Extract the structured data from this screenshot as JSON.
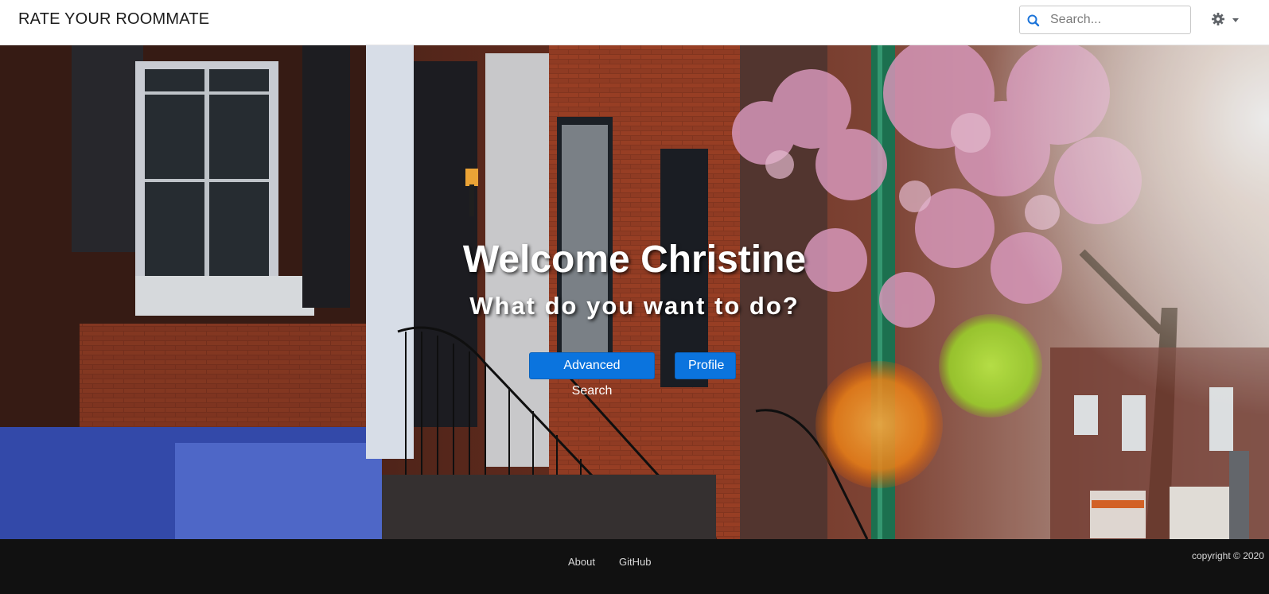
{
  "header": {
    "brand": "RATE YOUR ROOMMATE",
    "search": {
      "placeholder": "Search...",
      "value": ""
    },
    "settings_icon": "gear-icon",
    "settings_caret_icon": "caret-down-icon"
  },
  "hero": {
    "title": "Welcome Christine",
    "subtitle": "What do you want to do?",
    "buttons": {
      "advanced_search": "Advanced Search",
      "profile": "Profile"
    },
    "background": "street-brownstones-photo"
  },
  "footer": {
    "links": [
      "About",
      "GitHub"
    ],
    "copyright": "copyright © 2020"
  },
  "colors": {
    "primary_button": "#0b74de",
    "footer_bg": "#111111",
    "navbar_bg": "#ffffff"
  }
}
